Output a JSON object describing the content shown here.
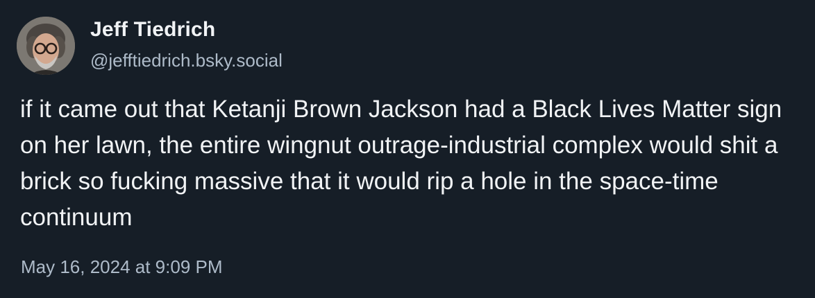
{
  "author": {
    "display_name": "Jeff Tiedrich",
    "handle": "@jefftiedrich.bsky.social",
    "avatar_icon": "profile-photo"
  },
  "post": {
    "text": "if it came out that Ketanji Brown Jackson had a Black Lives Matter sign on her lawn, the entire wingnut outrage-industrial complex would shit a brick so fucking massive that it would rip a hole in the space-time continuum",
    "timestamp": "May 16, 2024 at 9:09 PM"
  },
  "colors": {
    "background": "#161e27",
    "primary_text": "#f1f3f5",
    "secondary_text": "#aebbc9"
  }
}
